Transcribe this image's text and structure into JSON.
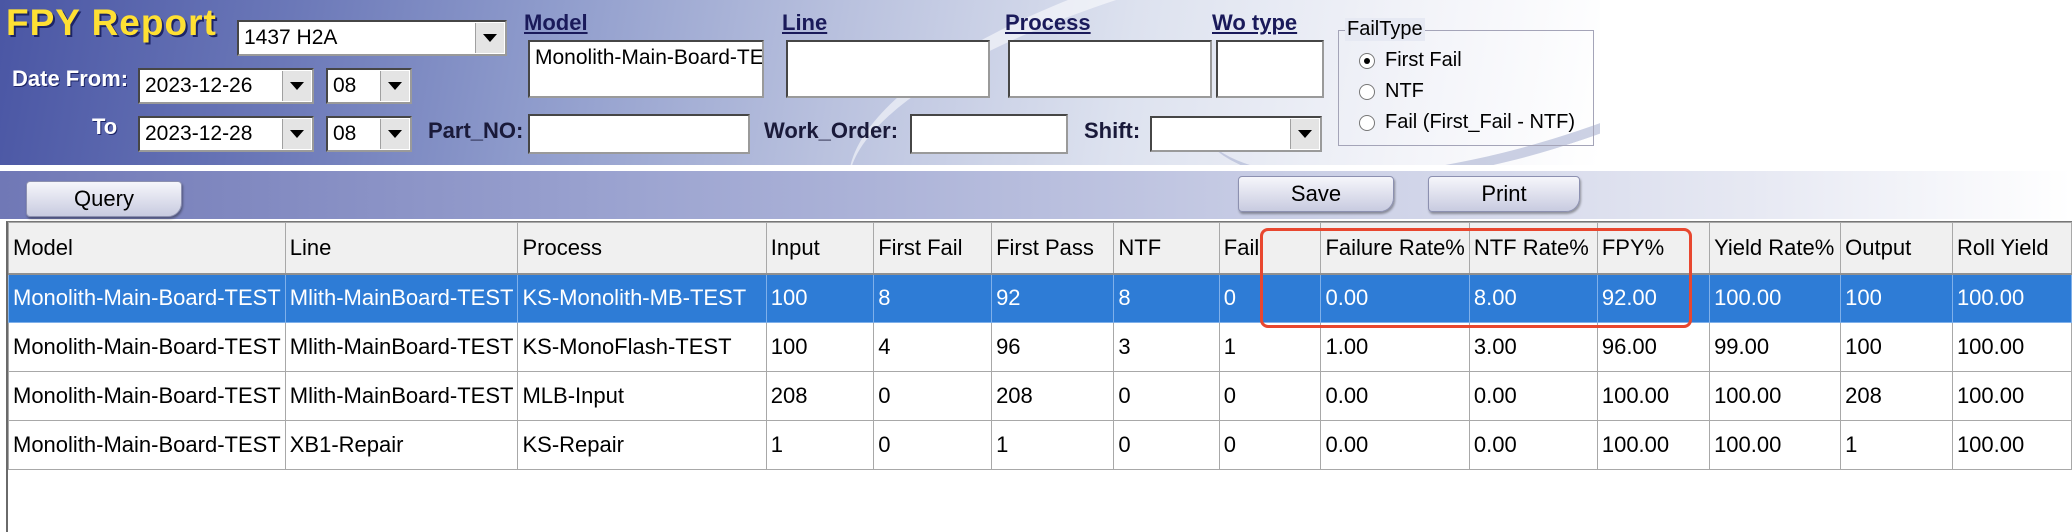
{
  "header": {
    "title": "FPY Report",
    "site_combo": "1437 H2A",
    "date_from_label": "Date From:",
    "date_from": "2023-12-26",
    "date_from_hour": "08",
    "to_label": "To",
    "date_to": "2023-12-28",
    "date_to_hour": "08",
    "model_label": "Model",
    "model_value": "Monolith-Main-Board-TE",
    "line_label": "Line",
    "line_value": "",
    "process_label": "Process",
    "process_value": "",
    "wo_type_label": "Wo type",
    "wo_type_value": "",
    "part_no_label": "Part_NO:",
    "part_no_value": "",
    "work_order_label": "Work_Order:",
    "work_order_value": "",
    "shift_label": "Shift:",
    "shift_value": ""
  },
  "fail_type": {
    "legend": "FailType",
    "options": [
      "First Fail",
      "NTF",
      "Fail (First_Fail - NTF)"
    ],
    "selected": "First Fail"
  },
  "toolbar": {
    "query_label": "Query",
    "save_label": "Save",
    "print_label": "Print"
  },
  "table": {
    "columns": [
      "Model",
      "Line",
      "Process",
      "Input",
      "First Fail",
      "First Pass",
      "NTF",
      "Fail",
      "Failure Rate%",
      "NTF Rate%",
      "FPY%",
      "Yield Rate%",
      "Output",
      "Roll Yield"
    ],
    "rows": [
      [
        "Monolith-Main-Board-TEST",
        "Mlith-MainBoard-TEST",
        "KS-Monolith-MB-TEST",
        "100",
        "8",
        "92",
        "8",
        "0",
        "0.00",
        "8.00",
        "92.00",
        "100.00",
        "100",
        "100.00"
      ],
      [
        "Monolith-Main-Board-TEST",
        "Mlith-MainBoard-TEST",
        "KS-MonoFlash-TEST",
        "100",
        "4",
        "96",
        "3",
        "1",
        "1.00",
        "3.00",
        "96.00",
        "99.00",
        "100",
        "100.00"
      ],
      [
        "Monolith-Main-Board-TEST",
        "Mlith-MainBoard-TEST",
        "MLB-Input",
        "208",
        "0",
        "208",
        "0",
        "0",
        "0.00",
        "0.00",
        "100.00",
        "100.00",
        "208",
        "100.00"
      ],
      [
        "Monolith-Main-Board-TEST",
        "XB1-Repair",
        "KS-Repair",
        "1",
        "0",
        "1",
        "0",
        "0",
        "0.00",
        "0.00",
        "100.00",
        "100.00",
        "1",
        "100.00"
      ]
    ],
    "selected_row": 0
  },
  "colors": {
    "title": "#ffe033",
    "selection": "#2e7cd6",
    "annotation": "#e8472f"
  }
}
